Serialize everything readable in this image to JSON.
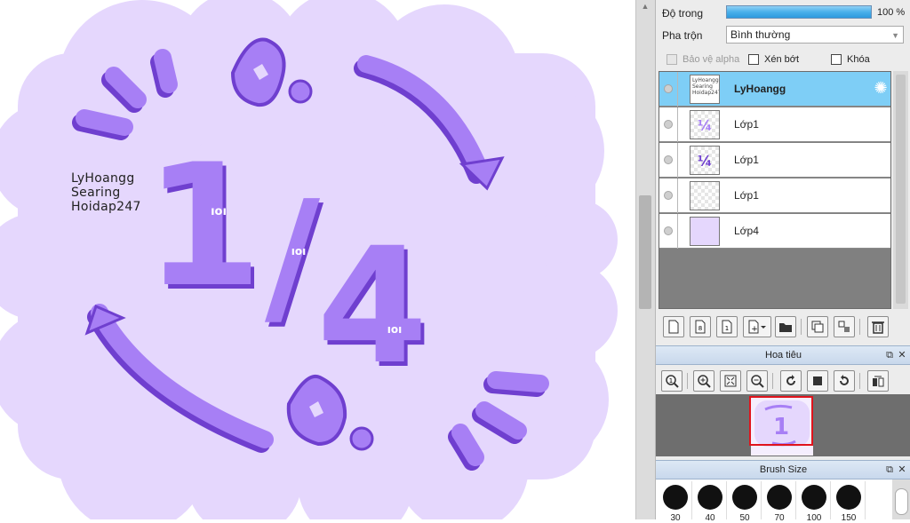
{
  "canvas": {
    "artist_note": [
      "LyHoangg",
      "Searing",
      "Hoidap247"
    ],
    "artwork_text": {
      "numerator": "1",
      "slash": "/",
      "denominator": "4",
      "doodle": "ıoı"
    },
    "colors": {
      "cloud": "#e5d7fd",
      "stroke": "#a77ff5",
      "stroke_shadow": "#6f3fcf"
    }
  },
  "layer_properties": {
    "opacity_label": "Độ trong",
    "opacity_value": "100 %",
    "opacity_percent": 100,
    "blend_label": "Pha trộn",
    "blend_value": "Bình thường",
    "protect_alpha_label": "Bảo vệ alpha",
    "clip_label": "Xén bớt",
    "lock_label": "Khóa"
  },
  "layers": [
    {
      "name": "LyHoangg",
      "active": true,
      "thumb": "text",
      "thumb_text": "LyHoangg Searing Hoidap247"
    },
    {
      "name": "Lớp1",
      "active": false,
      "thumb": "art"
    },
    {
      "name": "Lớp1",
      "active": false,
      "thumb": "art"
    },
    {
      "name": "Lớp1",
      "active": false,
      "thumb": "empty"
    },
    {
      "name": "Lớp4",
      "active": false,
      "thumb": "fill"
    }
  ],
  "navigator": {
    "title": "Hoa tiêu"
  },
  "brush_size": {
    "title": "Brush Size",
    "sizes": [
      "30",
      "40",
      "50",
      "70",
      "100",
      "150"
    ]
  },
  "colors": {
    "active_layer": "#7ecef6",
    "panel_bg": "#ececec",
    "opacity_fill": "#2e9ade",
    "nav_rect": "#e0141c"
  }
}
